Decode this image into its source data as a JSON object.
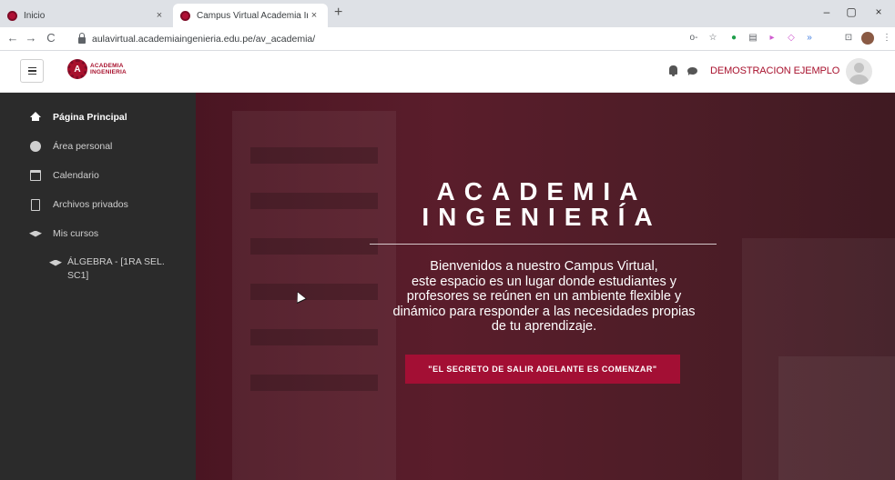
{
  "browser": {
    "tabs": [
      {
        "title": "Inicio",
        "active": false
      },
      {
        "title": "Campus Virtual Academia Ingeni",
        "active": true
      }
    ],
    "new_tab_glyph": "+",
    "close_glyph": "×",
    "url": "aulavirtual.academiaingenieria.edu.pe/av_academia/",
    "window_controls": {
      "minimize": "–",
      "maximize": "▢",
      "close": "×"
    },
    "nav_glyphs": {
      "back": "←",
      "forward": "→",
      "reload": "C"
    },
    "extension_icons": [
      "key-icon",
      "star-icon",
      "green-dot-icon",
      "cast-icon",
      "ext-icon",
      "ext-icon",
      "audio-icon",
      "media-icon"
    ],
    "extension_glyphs": [
      "o-",
      "☆",
      "●",
      "▤",
      "▸",
      "◇",
      "»",
      "⊡"
    ],
    "menu_glyph": "⋮"
  },
  "brand": {
    "logo_text_line1": "ACADEMIA",
    "logo_text_line2": "INGENIERIA",
    "logo_mark": "A",
    "accent_color": "#a8112d",
    "drawer_color": "#2b2b2b"
  },
  "navbar": {
    "user_name": "DEMOSTRACION EJEMPLO",
    "icons": [
      "bell-icon",
      "chat-icon"
    ]
  },
  "drawer": {
    "items": [
      {
        "label": "Página Principal",
        "icon": "home-icon",
        "active": true
      },
      {
        "label": "Área personal",
        "icon": "dashboard-icon",
        "active": false
      },
      {
        "label": "Calendario",
        "icon": "calendar-icon",
        "active": false
      },
      {
        "label": "Archivos privados",
        "icon": "file-icon",
        "active": false
      },
      {
        "label": "Mis cursos",
        "icon": "graduation-cap-icon",
        "active": false
      }
    ],
    "courses": [
      {
        "label": "ÁLGEBRA - [1RA SEL. SC1]",
        "icon": "graduation-cap-icon"
      }
    ]
  },
  "hero": {
    "title_line1": "ACADEMIA",
    "title_line2": "INGENIERÍA",
    "welcome_line1": "Bienvenidos a nuestro Campus Virtual,",
    "welcome_line2": "este espacio es un lugar donde estudiantes y",
    "welcome_line3": "profesores se reúnen en un ambiente flexible y",
    "welcome_line4": "dinámico para responder a las necesidades propias",
    "welcome_line5": "de tu aprendizaje.",
    "button_label": "\"EL SECRETO DE SALIR ADELANTE ES COMENZAR\""
  }
}
